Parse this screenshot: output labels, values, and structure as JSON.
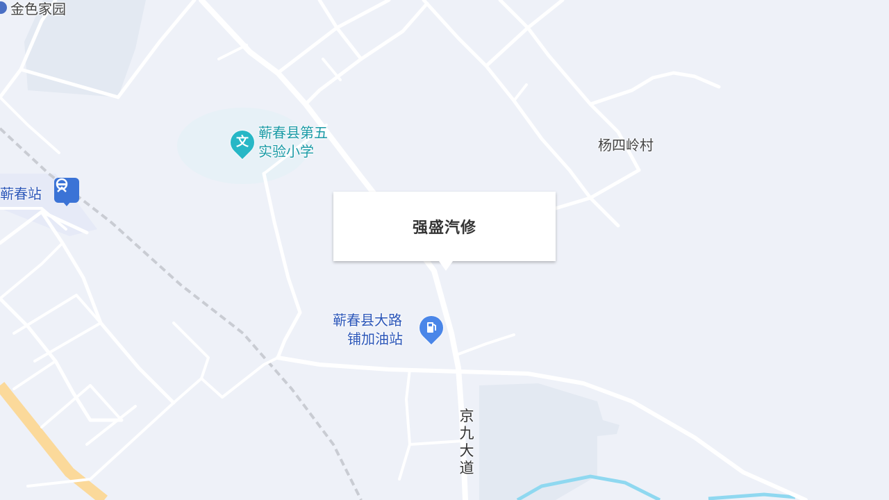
{
  "map": {
    "colors": {
      "land": "#eef1f8",
      "block": "#e3e9f2",
      "road": "#ffffff",
      "highway": "#fbd99a",
      "railway": "#c9ccd3",
      "water": "#8fd8f0",
      "poi_text_blue": "#2a55b8",
      "poi_text_teal": "#1a9aa6",
      "village_text": "#444444"
    },
    "popup": {
      "title": "强盛汽修"
    },
    "labels": {
      "jinse_jiayuan": "金色家园",
      "school_line1": "蕲春县第五",
      "school_line2": "实验小学",
      "station": "蕲春站",
      "gas_line1": "蕲春县大路",
      "gas_line2": "铺加油站",
      "village": "杨四岭村",
      "road": "京九大道"
    },
    "icons": {
      "school": "education-pin-icon",
      "station": "railway-station-icon",
      "gas": "gas-station-pin-icon",
      "residential": "residential-pin-icon"
    },
    "icon_glyphs": {
      "school": "文"
    }
  }
}
